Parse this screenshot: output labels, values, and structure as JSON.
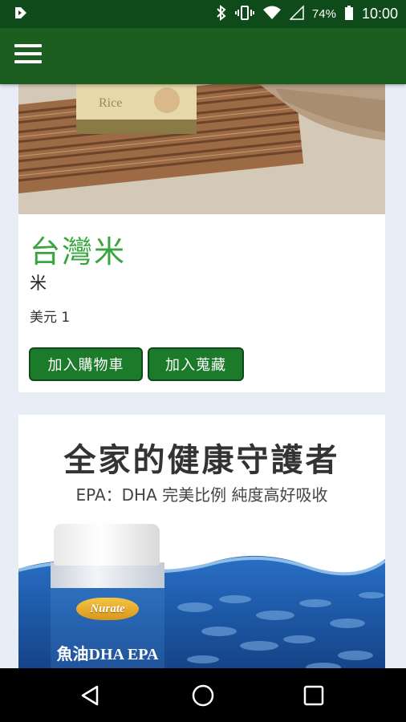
{
  "status_bar": {
    "battery_percent": "74%",
    "time": "10:00",
    "icons": [
      "app-notification-icon",
      "bluetooth-icon",
      "vibrate-icon",
      "wifi-icon",
      "signal-icon",
      "battery-icon"
    ]
  },
  "app_bar": {
    "menu_icon": "hamburger-menu-icon"
  },
  "product": {
    "title": "台灣米",
    "subtitle": "米",
    "price": "美元 1",
    "add_to_cart_label": "加入購物車",
    "add_to_favorites_label": "加入蒐藏"
  },
  "ad": {
    "headline": "全家的健康守護者",
    "subline": "EPA：DHA 完美比例 純度高好吸收",
    "brand": "Nurate",
    "bottle_text": "魚油DHA EPA"
  },
  "nav_bar": {
    "icons": [
      "back-icon",
      "home-icon",
      "recent-apps-icon"
    ]
  },
  "colors": {
    "status_bar": "#0f4a1b",
    "app_bar": "#1b5e20",
    "title_green": "#39a53f",
    "button_green": "#1b7b2a"
  }
}
